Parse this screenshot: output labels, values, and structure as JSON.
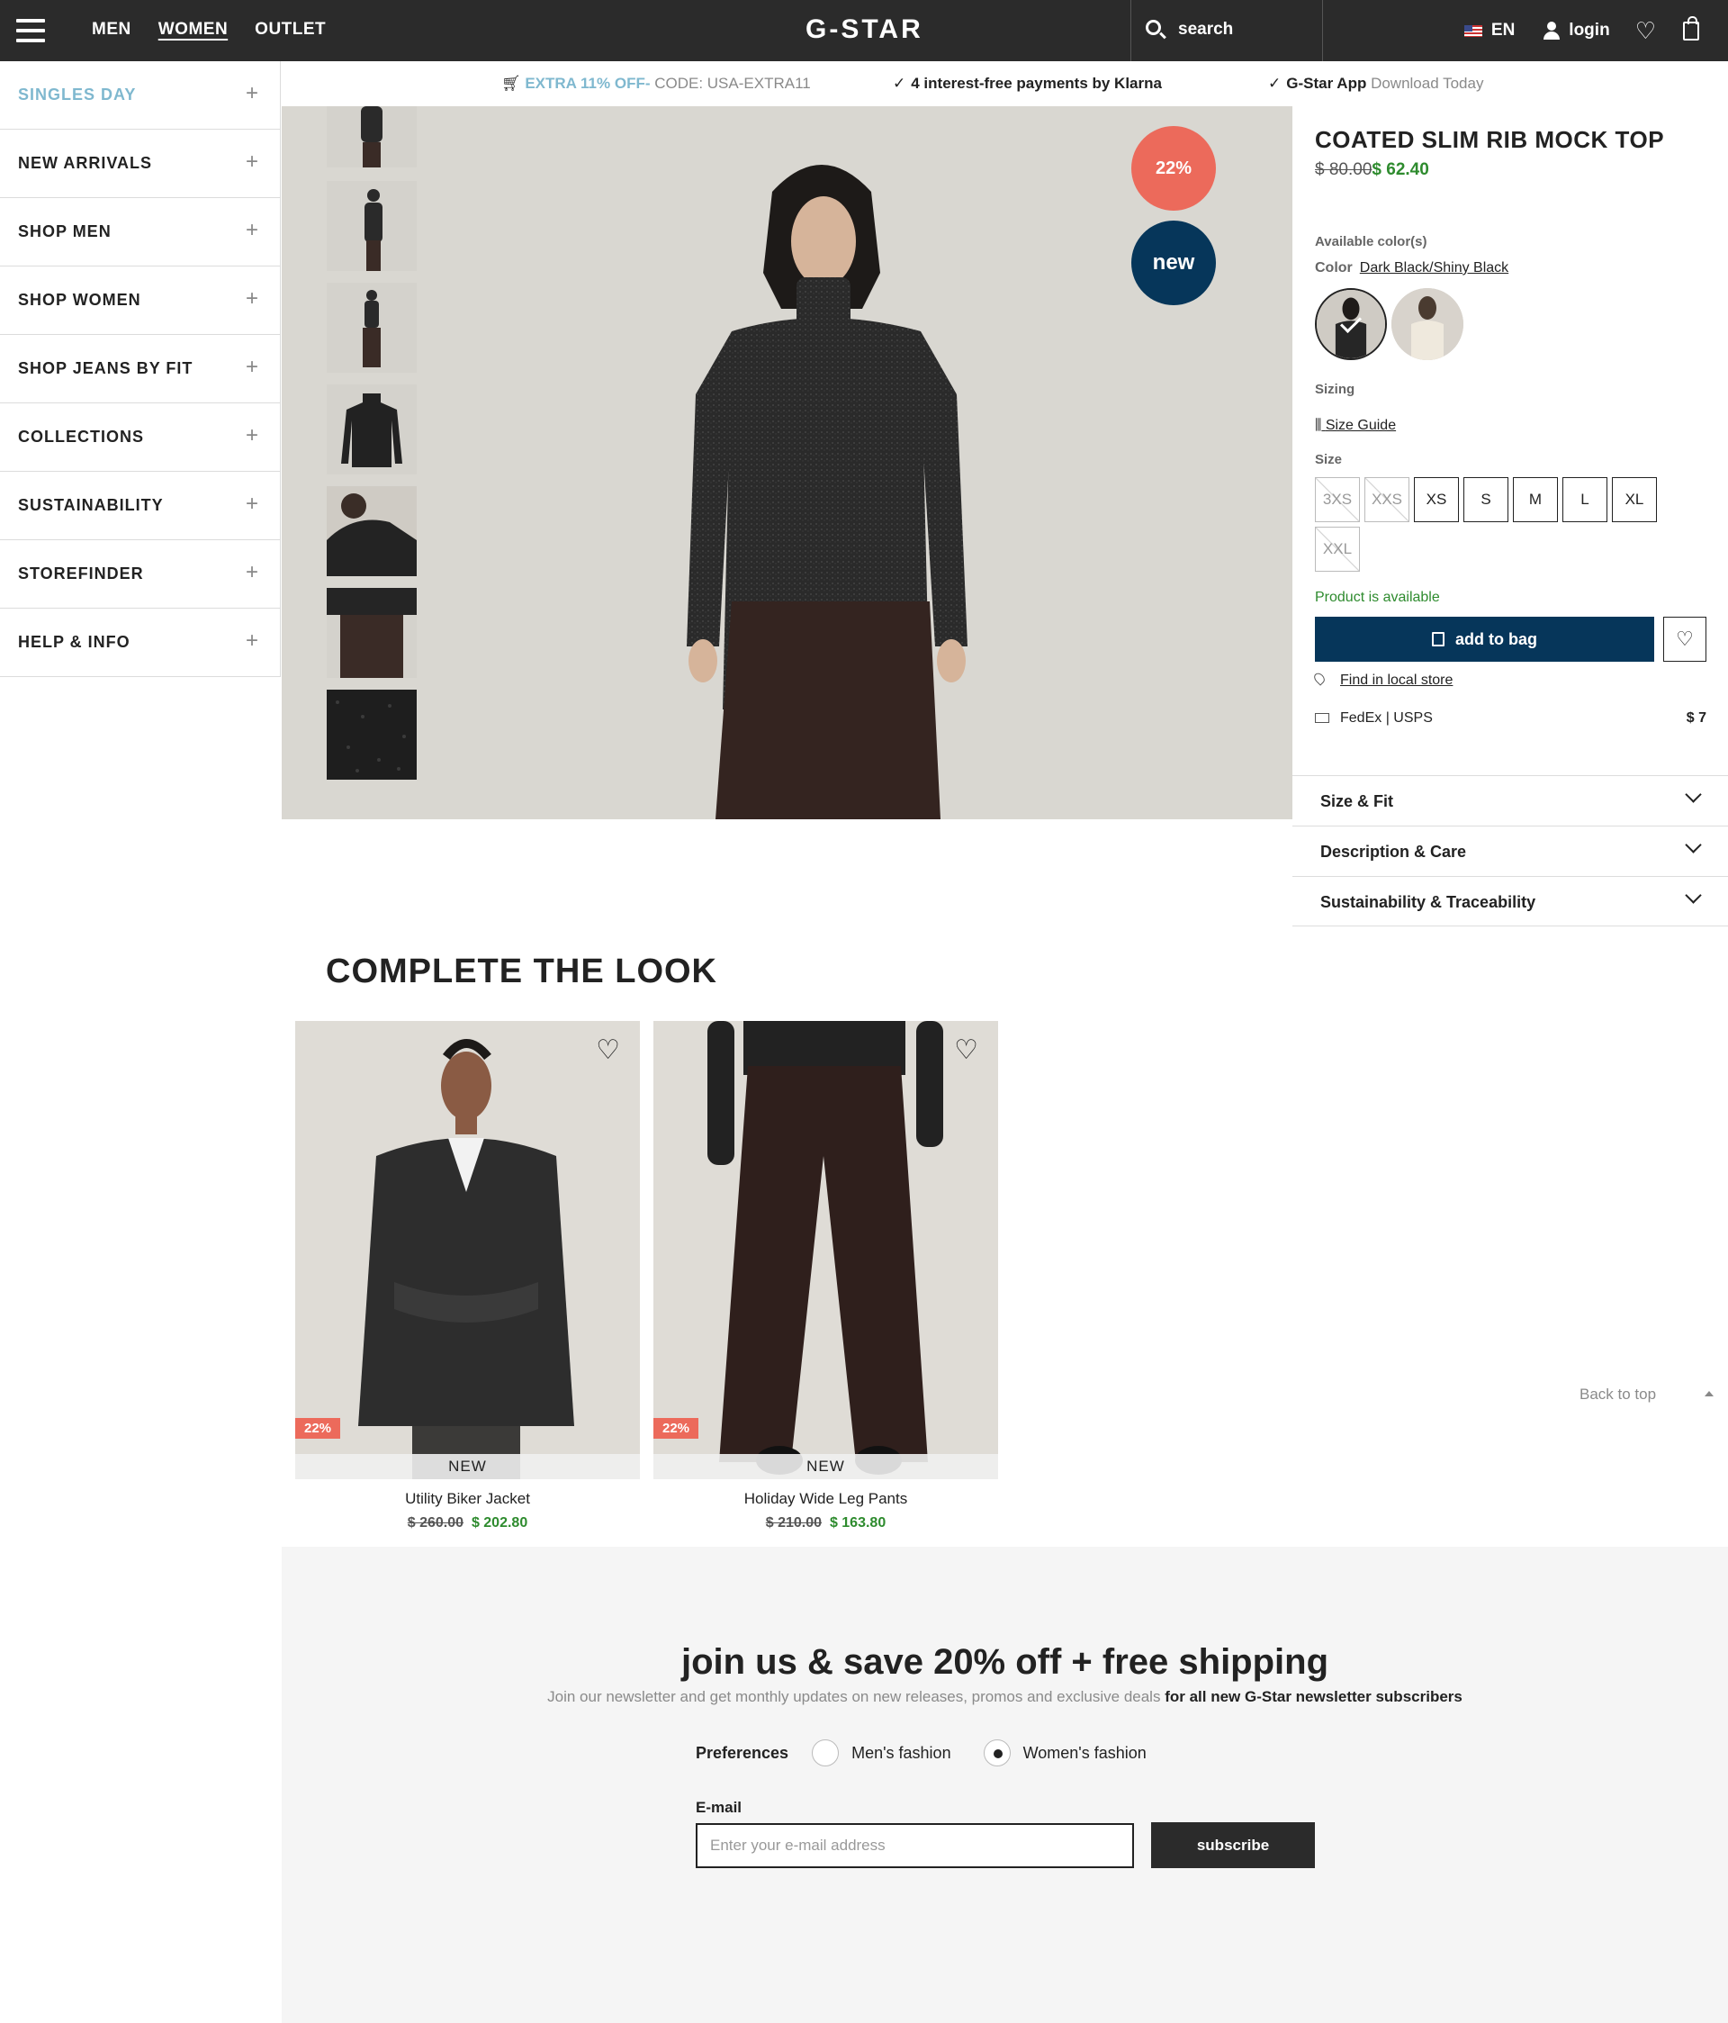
{
  "header": {
    "nav": [
      "MEN",
      "WOMEN",
      "OUTLET"
    ],
    "active_nav": "WOMEN",
    "logo": "G-STAR",
    "search_label": "search",
    "language": "EN",
    "login_label": "login"
  },
  "promo": {
    "offer_highlight": "EXTRA 11% OFF-",
    "offer_code": " CODE: USA-EXTRA11",
    "klarna": "4 interest-free payments by Klarna",
    "app_label": "G-Star App",
    "app_sub": " Download Today"
  },
  "sidebar": {
    "items": [
      {
        "label": "SINGLES DAY",
        "highlight": true
      },
      {
        "label": "NEW ARRIVALS"
      },
      {
        "label": "SHOP MEN"
      },
      {
        "label": "SHOP WOMEN"
      },
      {
        "label": "SHOP JEANS BY FIT"
      },
      {
        "label": "COLLECTIONS"
      },
      {
        "label": "SUSTAINABILITY"
      },
      {
        "label": "STOREFINDER"
      },
      {
        "label": "HELP & INFO"
      }
    ]
  },
  "gallery": {
    "badge_discount": "22%",
    "badge_new": "new",
    "thumbnail_count": 7
  },
  "product": {
    "title": "COATED SLIM RIB MOCK TOP",
    "price_old": "$ 80.00",
    "price_new": "$ 62.40",
    "available_colors_label": "Available color(s)",
    "color_key": "Color",
    "color_value": "Dark Black/Shiny Black",
    "sizing_label": "Sizing",
    "size_guide": "Size Guide",
    "size_label": "Size",
    "sizes": [
      {
        "label": "3XS",
        "available": false
      },
      {
        "label": "XXS",
        "available": false
      },
      {
        "label": "XS",
        "available": true
      },
      {
        "label": "S",
        "available": true
      },
      {
        "label": "M",
        "available": true
      },
      {
        "label": "L",
        "available": true
      },
      {
        "label": "XL",
        "available": true
      },
      {
        "label": "XXL",
        "available": false
      }
    ],
    "availability": "Product is available",
    "add_to_bag": "add to bag",
    "find_store": "Find in local store",
    "shipping": "FedEx | USPS",
    "shipping_cost": "$ 7",
    "accordions": [
      "Size & Fit",
      "Description & Care",
      "Sustainability & Traceability"
    ]
  },
  "complete_look": {
    "title": "COMPLETE THE LOOK",
    "items": [
      {
        "name": "Utility Biker Jacket",
        "old": "$ 260.00",
        "new": "$ 202.80",
        "discount": "22%",
        "tag": "NEW"
      },
      {
        "name": "Holiday Wide Leg Pants",
        "old": "$ 210.00",
        "new": "$ 163.80",
        "discount": "22%",
        "tag": "NEW"
      }
    ],
    "back_to_top": "Back to top"
  },
  "newsletter": {
    "title": "join us & save 20% off + free shipping",
    "subtitle": "Join our newsletter and get monthly updates on new releases, promos and exclusive deals ",
    "subtitle_bold": "for all new G-Star newsletter subscribers",
    "preferences_label": "Preferences",
    "option_men": "Men's fashion",
    "option_women": "Women's fashion",
    "selected_option": "Women's fashion",
    "email_label": "E-mail",
    "email_placeholder": "Enter your e-mail address",
    "subscribe": "subscribe"
  },
  "colors": {
    "header_bg": "#2b2b2b",
    "accent_blue": "#7fb8cf",
    "navy": "#06365a",
    "sale_red": "#ec6a5b",
    "price_green": "#2e8b2e"
  }
}
